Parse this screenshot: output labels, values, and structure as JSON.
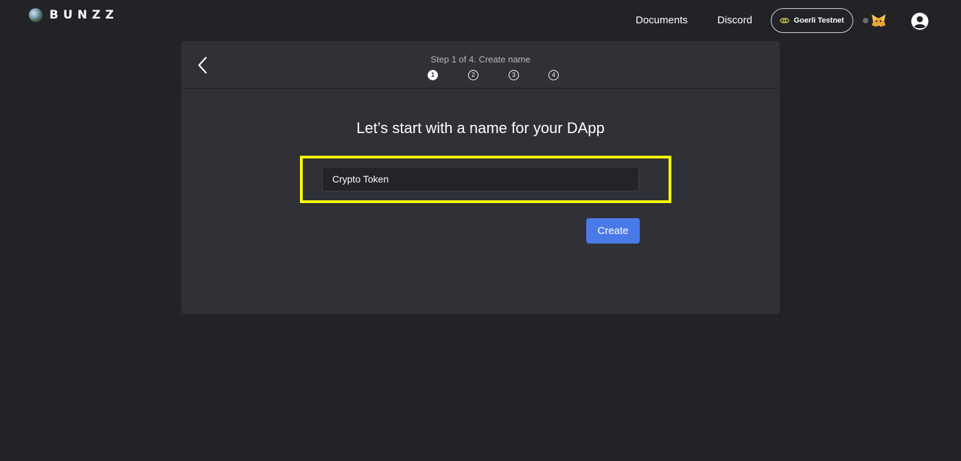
{
  "app": {
    "logo_text": "BUNZZ"
  },
  "nav": {
    "documents": "Documents",
    "discord": "Discord",
    "network": "Goerli Testnet"
  },
  "wizard": {
    "step_title": "Step 1 of 4. Create name",
    "steps": [
      "1",
      "2",
      "3",
      "4"
    ],
    "active_step": 1,
    "heading": "Let’s start with a name for your DApp",
    "name_value": "Crypto Token",
    "create_label": "Create"
  },
  "icons": {
    "logo": "globe-icon",
    "back": "chevron-left-icon",
    "network": "chain-link-icon",
    "wallet": "metamask-fox-icon",
    "account": "user-avatar-icon"
  },
  "colors": {
    "background": "#222327",
    "card": "#2f3136",
    "accent": "#4a7ae8",
    "highlight": "#ffff00",
    "network_icon": "#c9c93a"
  }
}
